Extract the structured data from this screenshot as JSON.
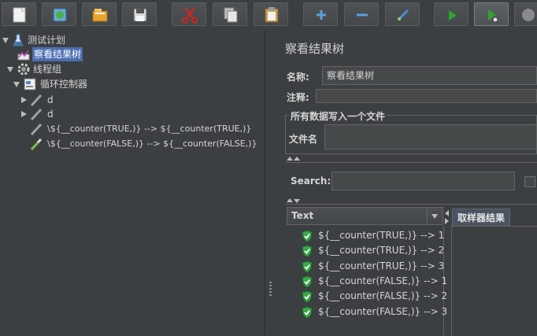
{
  "toolbar": {
    "buttons": [
      {
        "name": "new-icon"
      },
      {
        "name": "templates-icon"
      },
      {
        "name": "open-icon"
      },
      {
        "name": "save-icon"
      },
      {
        "name": "cut-icon"
      },
      {
        "name": "copy-icon"
      },
      {
        "name": "paste-icon"
      },
      {
        "name": "expand-icon"
      },
      {
        "name": "collapse-icon"
      },
      {
        "name": "toggle-icon"
      },
      {
        "name": "start-icon"
      },
      {
        "name": "start-no-pauses-icon"
      },
      {
        "name": "stop-icon"
      }
    ]
  },
  "tree": {
    "test_plan": "测试计划",
    "view_results_tree": "察看结果树",
    "thread_group": "线程组",
    "loop_controller": "循环控制器",
    "sampler_d1": "d",
    "sampler_d2": "d",
    "sampler_true": "\\${__counter(TRUE,)} --> ${__counter(TRUE,)}",
    "sampler_false": "\\${__counter(FALSE,)} --> ${__counter(FALSE,)}"
  },
  "panel": {
    "title": "察看结果树",
    "name_label": "名称:",
    "name_value": "察看结果树",
    "comment_label": "注释:",
    "write_group_title": "所有数据写入一个文件",
    "filename_label": "文件名",
    "search_label": "Search:",
    "list_header": "Text",
    "results": [
      "${__counter(TRUE,)} --> 1",
      "${__counter(TRUE,)} --> 2",
      "${__counter(TRUE,)} --> 3",
      "${__counter(FALSE,)} --> 1",
      "${__counter(FALSE,)} --> 2",
      "${__counter(FALSE,)} --> 3"
    ],
    "tab_sampler_result": "取样器结果"
  },
  "colors": {
    "background": "#3c3f41",
    "selection": "#4b6eaf",
    "success": "#3aa64a",
    "start": "#2fa52f",
    "cut": "#d02424"
  }
}
